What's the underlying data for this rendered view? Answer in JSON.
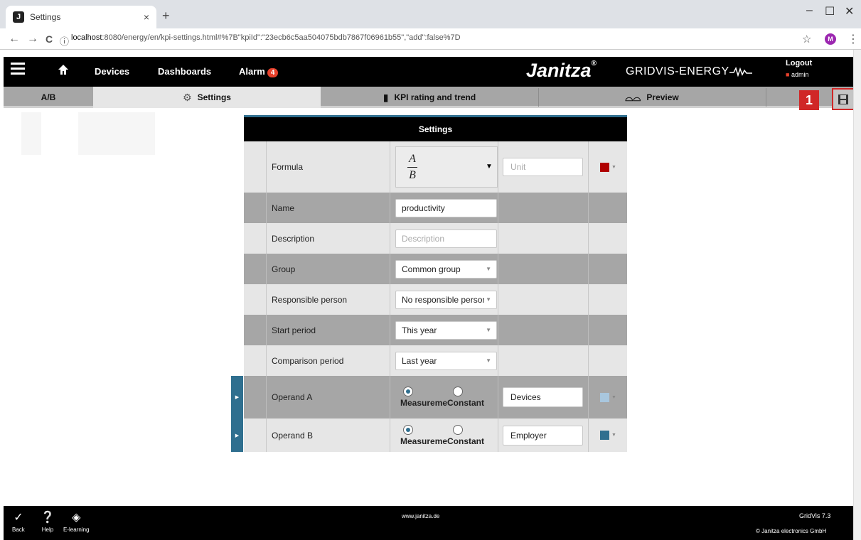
{
  "browser": {
    "tab_title": "Settings",
    "tab_favicon": "J",
    "tab_close": "×",
    "new_tab": "+",
    "win_minimize": "–",
    "win_maximize": "☐",
    "win_close": "✕",
    "back": "←",
    "forward": "→",
    "reload": "C",
    "info": "ⓘ",
    "url_host": "localhost",
    "url_rest": ":8080/energy/en/kpi-settings.html#%7B\"kpiId\":\"23ecb6c5aa504075bdb7867f06961b55\",\"add\":false%7D",
    "bookmark": "☆",
    "profile": "M",
    "menu": "⋮"
  },
  "appbar": {
    "home_icon": "🏠",
    "devices": "Devices",
    "dashboards": "Dashboards",
    "alarm": "Alarm",
    "alarm_count": "4",
    "brand": "Janitza",
    "brand_mark": "®",
    "brand_sub": "GRIDVIS-ENERGY",
    "logout": "Logout",
    "user": "admin"
  },
  "subtabs": {
    "ab": "A/B",
    "settings": "Settings",
    "kpi": "KPI rating and trend",
    "preview": "Preview",
    "step": "1",
    "settings_icon": "⚙",
    "kpi_icon": "▮",
    "preview_icon": "⌓⌓"
  },
  "panel": {
    "title": "Settings",
    "rows": {
      "formula": {
        "label": "Formula",
        "num": "A",
        "den": "B",
        "unit_placeholder": "Unit",
        "color": "#b00000"
      },
      "name": {
        "label": "Name",
        "value": "productivity"
      },
      "description": {
        "label": "Description",
        "placeholder": "Description"
      },
      "group": {
        "label": "Group",
        "value": "Common group"
      },
      "responsible": {
        "label": "Responsible person",
        "value": "No responsible person"
      },
      "start": {
        "label": "Start period",
        "value": "This year"
      },
      "comparison": {
        "label": "Comparison period",
        "value": "Last year"
      },
      "operand_a": {
        "label": "Operand A",
        "radio1": "Measuremen",
        "radio2": "Constant",
        "value": "Devices",
        "color": "#a9c7de"
      },
      "operand_b": {
        "label": "Operand B",
        "radio1": "Measuremen",
        "radio2": "Constant",
        "value": "Employer",
        "color": "#2f6f8f"
      }
    }
  },
  "footer": {
    "back": "Back",
    "help": "Help",
    "elearning": "E-learning",
    "site": "www.janitza.de",
    "version": "GridVis 7.3",
    "copyright": "© Janitza electronics GmbH"
  }
}
